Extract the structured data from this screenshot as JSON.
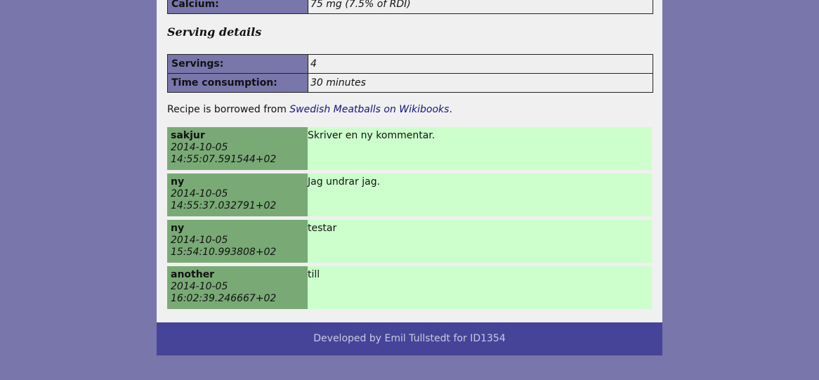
{
  "nutrition": {
    "rows": [
      {
        "label": "Calcium:",
        "value": "75 mg (7.5% of RDI)"
      }
    ]
  },
  "serving": {
    "heading": "Serving details",
    "rows": [
      {
        "label": "Servings:",
        "value": "4"
      },
      {
        "label": "Time consumption:",
        "value": "30 minutes"
      }
    ]
  },
  "source": {
    "prefix": "Recipe is borrowed from ",
    "link_text": "Swedish Meatballs on Wikibooks",
    "suffix": "."
  },
  "comments": [
    {
      "author": "sakjur",
      "date": "2014-10-05 14:55:07.591544+02",
      "text": "Skriver en ny kommentar."
    },
    {
      "author": "ny",
      "date": "2014-10-05 14:55:37.032791+02",
      "text": "Jag undrar jag."
    },
    {
      "author": "ny",
      "date": "2014-10-05 15:54:10.993808+02",
      "text": "testar"
    },
    {
      "author": "another",
      "date": "2014-10-05 16:02:39.246667+02",
      "text": "till"
    }
  ],
  "footer": {
    "text": "Developed by Emil Tullstedt for ID1354"
  },
  "colors": {
    "background": "#7876aa",
    "content": "#f0f0f0",
    "label_cell": "#7876aa",
    "comment_meta": "#79aa76",
    "comment_body": "#ccffcc",
    "footer": "#454499",
    "link": "#141480"
  }
}
